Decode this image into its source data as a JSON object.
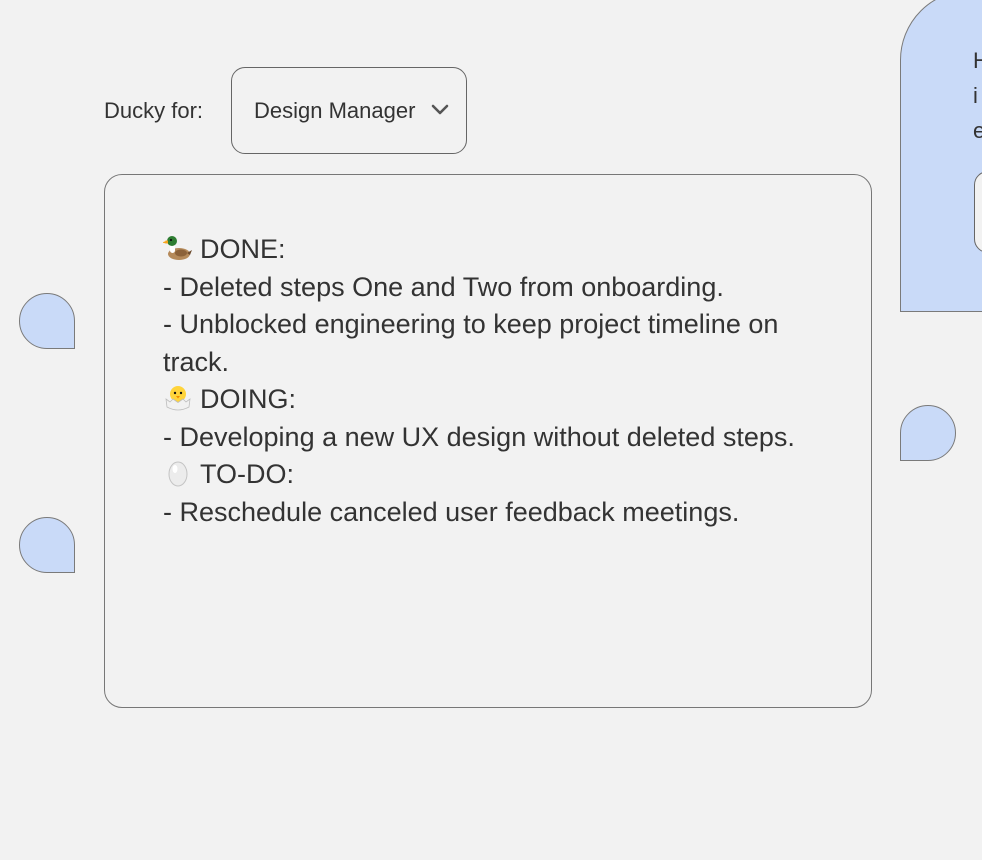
{
  "selector": {
    "label": "Ducky for:",
    "value": "Design Manager",
    "options_visible": [
      "Design Manager"
    ]
  },
  "output": {
    "sections": [
      {
        "icon": "duck-icon",
        "heading": "DONE:",
        "items": [
          "- Deleted steps One and Two from onboarding.",
          "- Unblocked engineering to keep project timeline on track."
        ]
      },
      {
        "icon": "hatching-chick-icon",
        "heading": "DOING:",
        "items": [
          "- Developing a new UX design without deleted steps."
        ]
      },
      {
        "icon": "egg-icon",
        "heading": "TO-DO:",
        "items": [
          "- Reschedule canceled user feedback meetings."
        ]
      }
    ]
  },
  "side_panel": {
    "text_visible": "H\ni\ne"
  },
  "colors": {
    "background": "#f2f2f2",
    "bubble_fill": "#c9daf8",
    "text": "#333333",
    "border": "#777777"
  }
}
